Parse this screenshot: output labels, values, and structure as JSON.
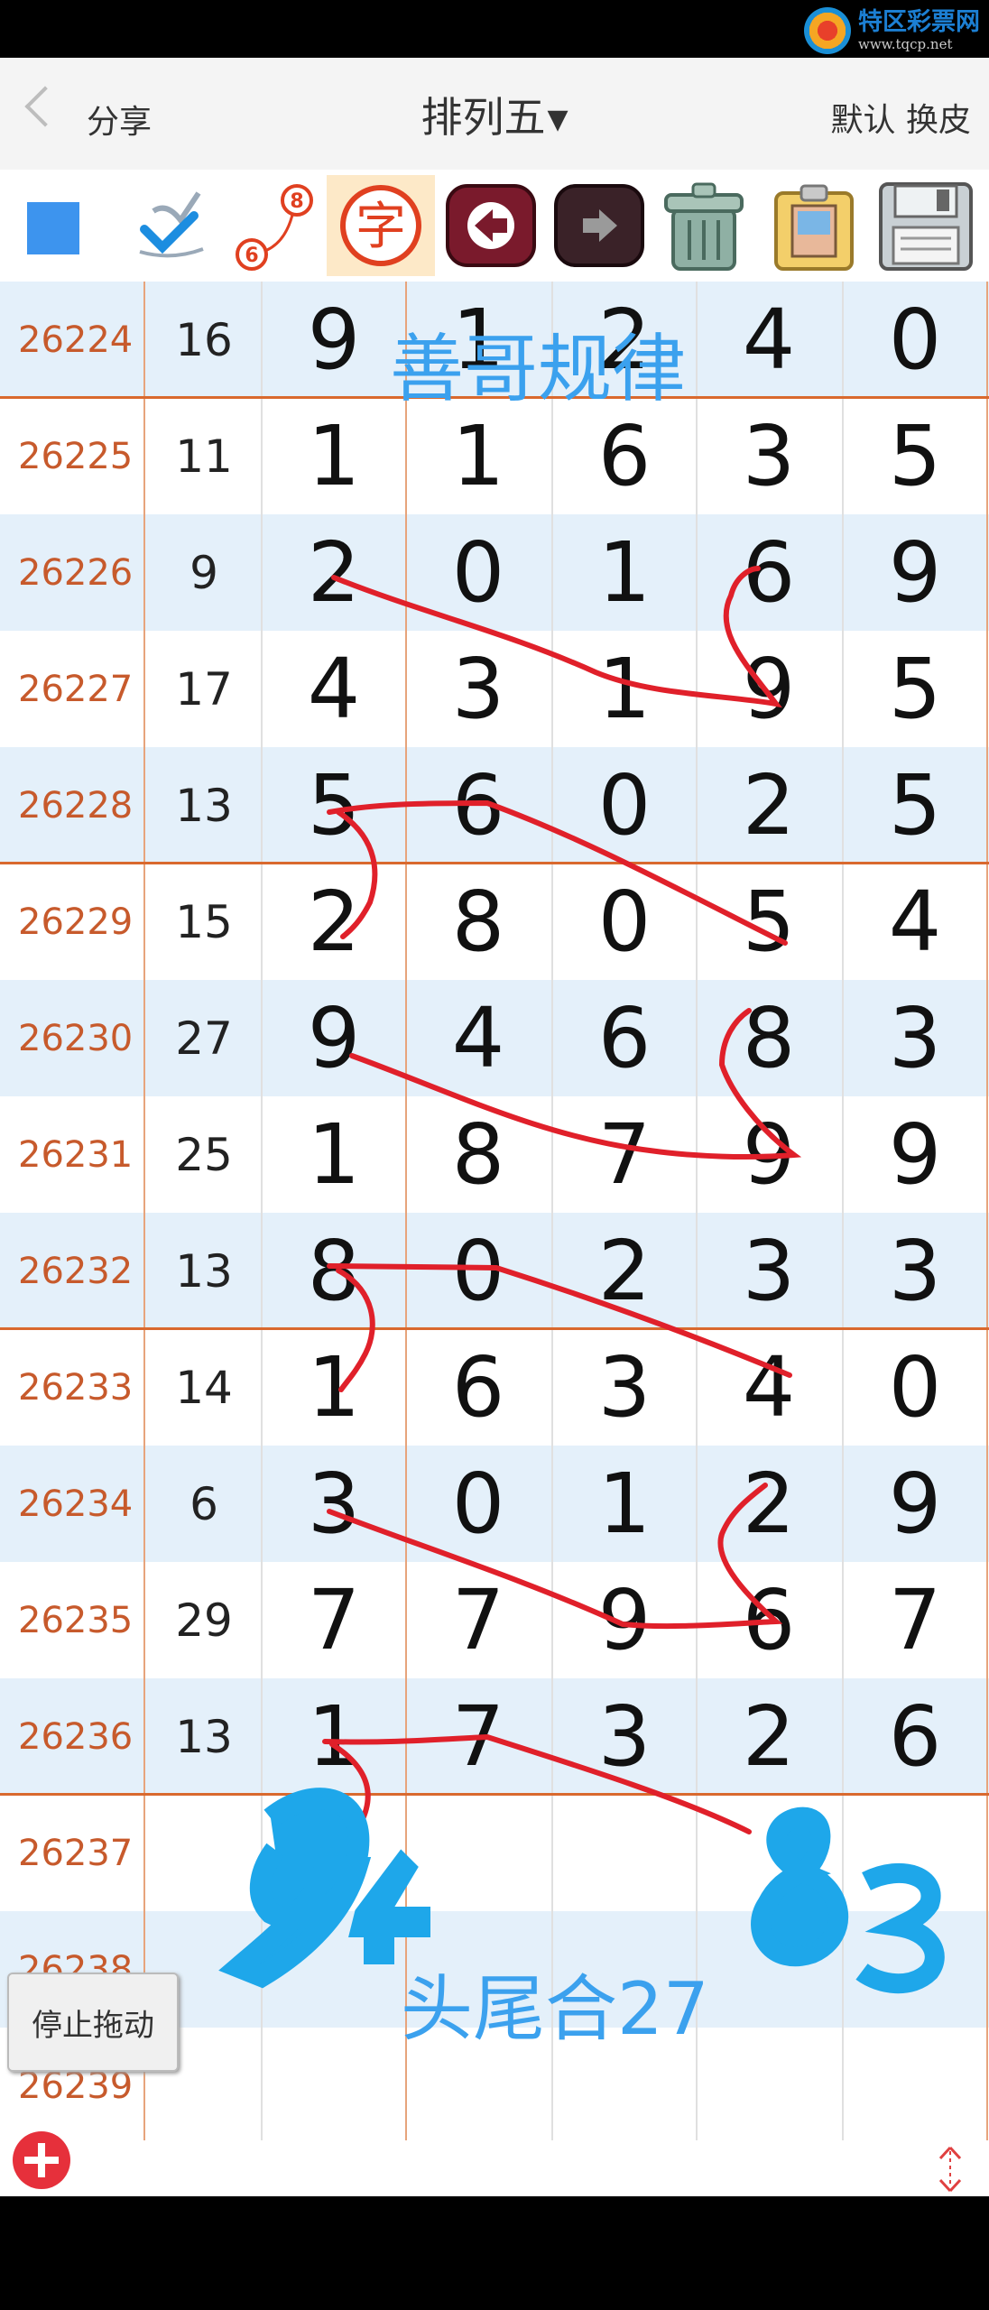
{
  "logo": {
    "name": "特区彩票网",
    "url": "www.tqcp.net"
  },
  "nav": {
    "share": "分享",
    "title": "排列五",
    "right": "默认 换皮"
  },
  "toolbar": {
    "icons": [
      "blue-square-icon",
      "check-brush-icon",
      "node-6-8-icon",
      "zi-character-icon",
      "arrow-left-icon",
      "arrow-right-icon",
      "trash-can-icon",
      "paste-board-icon",
      "floppy-save-icon"
    ]
  },
  "rows": [
    {
      "issue": "26224",
      "sum": "16",
      "d": [
        "9",
        "1",
        "2",
        "4",
        "0"
      ]
    },
    {
      "issue": "26225",
      "sum": "11",
      "d": [
        "1",
        "1",
        "6",
        "3",
        "5"
      ]
    },
    {
      "issue": "26226",
      "sum": "9",
      "d": [
        "2",
        "0",
        "1",
        "6",
        "9"
      ]
    },
    {
      "issue": "26227",
      "sum": "17",
      "d": [
        "4",
        "3",
        "1",
        "9",
        "5"
      ]
    },
    {
      "issue": "26228",
      "sum": "13",
      "d": [
        "5",
        "6",
        "0",
        "2",
        "5"
      ]
    },
    {
      "issue": "26229",
      "sum": "15",
      "d": [
        "2",
        "8",
        "0",
        "5",
        "4"
      ]
    },
    {
      "issue": "26230",
      "sum": "27",
      "d": [
        "9",
        "4",
        "6",
        "8",
        "3"
      ]
    },
    {
      "issue": "26231",
      "sum": "25",
      "d": [
        "1",
        "8",
        "7",
        "9",
        "9"
      ]
    },
    {
      "issue": "26232",
      "sum": "13",
      "d": [
        "8",
        "0",
        "2",
        "3",
        "3"
      ]
    },
    {
      "issue": "26233",
      "sum": "14",
      "d": [
        "1",
        "6",
        "3",
        "4",
        "0"
      ]
    },
    {
      "issue": "26234",
      "sum": "6",
      "d": [
        "3",
        "0",
        "1",
        "2",
        "9"
      ]
    },
    {
      "issue": "26235",
      "sum": "29",
      "d": [
        "7",
        "7",
        "9",
        "6",
        "7"
      ]
    },
    {
      "issue": "26236",
      "sum": "13",
      "d": [
        "1",
        "7",
        "3",
        "2",
        "6"
      ]
    },
    {
      "issue": "26237",
      "sum": "",
      "d": [
        "",
        "",
        "",
        "",
        ""
      ]
    },
    {
      "issue": "26238",
      "sum": "",
      "d": [
        "",
        "",
        "",
        "",
        ""
      ]
    },
    {
      "issue": "26239",
      "sum": "",
      "d": [
        "",
        "",
        "",
        "",
        ""
      ]
    }
  ],
  "annotations": {
    "title": "善哥规律",
    "hint": "头尾合27",
    "left_pick": "94",
    "right_pick": "83"
  },
  "buttons": {
    "stop_drag": "停止拖动"
  },
  "colors": {
    "issue_text": "#c75a2c",
    "separator": "#d9692e",
    "stripe": "#e4f0fa",
    "annotation_blue": "#3ba1ee",
    "annotation_red": "#e0202a"
  }
}
